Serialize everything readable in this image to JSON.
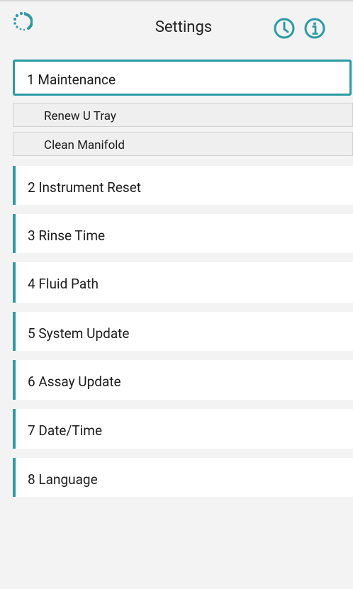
{
  "header": {
    "title": "Settings",
    "logo_icon": "spinner-logo-icon",
    "history_icon": "clock-icon",
    "info_icon": "info-icon",
    "accent_color": "#2a9ba4"
  },
  "menu": {
    "items": [
      {
        "label": "1  Maintenance",
        "active": true
      },
      {
        "label": "2  Instrument Reset"
      },
      {
        "label": "3  Rinse Time"
      },
      {
        "label": "4  Fluid Path"
      },
      {
        "label": "5  System Update"
      },
      {
        "label": "6  Assay Update"
      },
      {
        "label": "7  Date/Time"
      },
      {
        "label": "8  Language"
      }
    ],
    "subitems": [
      {
        "label": "Renew U Tray"
      },
      {
        "label": "Clean Manifold"
      }
    ]
  }
}
